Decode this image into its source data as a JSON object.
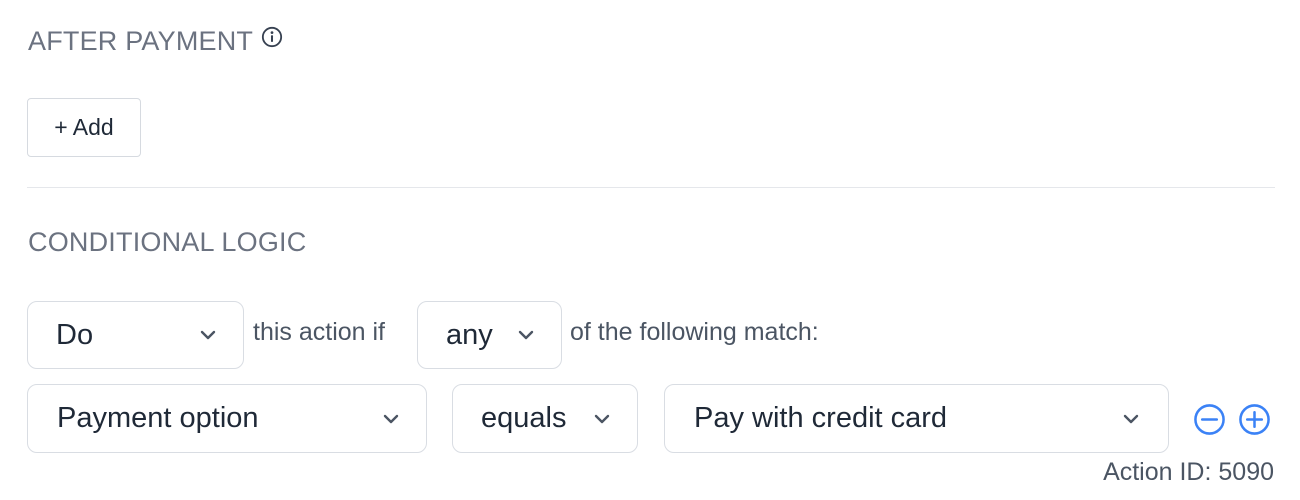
{
  "after_payment": {
    "title": "AFTER PAYMENT",
    "info_icon": "info-circle-icon",
    "add_button_label": "+ Add"
  },
  "conditional_logic": {
    "title": "CONDITIONAL LOGIC",
    "do_select": {
      "value": "Do"
    },
    "text_before_match": "this action if",
    "match_select": {
      "value": "any"
    },
    "text_after_match": "of the following match:",
    "rule": {
      "field_select": {
        "value": "Payment option"
      },
      "operator_select": {
        "value": "equals"
      },
      "value_select": {
        "value": "Pay with credit card"
      },
      "remove_icon": "minus-circle-icon",
      "add_icon": "plus-circle-icon"
    }
  },
  "footer": {
    "action_id": "Action ID: 5090"
  },
  "colors": {
    "accent": "#3b82f6",
    "muted_text": "#6b7280",
    "border": "#d9dde3"
  }
}
